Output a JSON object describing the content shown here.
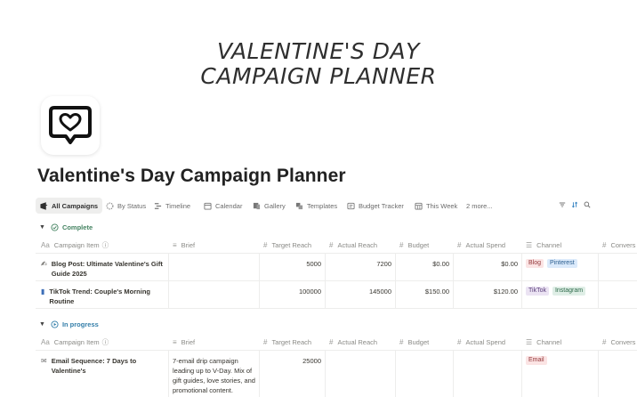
{
  "cover": {
    "title_line1": "VALENTINE'S DAY",
    "title_line2": "CAMPAIGN PLANNER"
  },
  "page": {
    "title": "Valentine's Day Campaign Planner",
    "icon": "heart-message-icon"
  },
  "views": {
    "tabs": [
      {
        "label": "All Campaigns",
        "icon": "table-icon"
      },
      {
        "label": "By Status",
        "icon": "status-icon"
      },
      {
        "label": "Timeline",
        "icon": "timeline-icon"
      },
      {
        "label": "Calendar",
        "icon": "calendar-icon"
      },
      {
        "label": "Gallery",
        "icon": "gallery-icon"
      },
      {
        "label": "Templates",
        "icon": "templates-icon"
      },
      {
        "label": "Budget Tracker",
        "icon": "board-icon"
      },
      {
        "label": "This Week",
        "icon": "calendar-week-icon"
      }
    ],
    "more_label": "2 more..."
  },
  "columns": [
    "Campaign Item",
    "Brief",
    "Target Reach",
    "Actual Reach",
    "Budget",
    "Actual Spend",
    "Channel",
    "Convers"
  ],
  "groups": [
    {
      "label": "Complete",
      "color": "#448361",
      "rows": [
        {
          "name_line1": "Blog Post: Ultimate Valentine's Gift",
          "name_line2": "Guide 2025",
          "icon": "pencil-icon",
          "brief": [
            "",
            "",
            "",
            ""
          ],
          "target_reach": "5000",
          "actual_reach": "7200",
          "budget": "$0.00",
          "actual_spend": "$0.00",
          "channels": [
            "Blog",
            "Pinterest"
          ]
        },
        {
          "name_line1": "TikTok Trend: Couple's Morning",
          "name_line2": "Routine",
          "icon": "phone-icon",
          "brief": [
            "",
            "",
            "",
            ""
          ],
          "target_reach": "100000",
          "actual_reach": "145000",
          "budget": "$150.00",
          "actual_spend": "$120.00",
          "channels": [
            "TikTok",
            "Instagram"
          ]
        }
      ]
    },
    {
      "label": "In progress",
      "color": "#337ea9",
      "rows": [
        {
          "name_line1": "Email Sequence: 7 Days to",
          "name_line2": "Valentine's",
          "icon": "email-icon",
          "brief": [
            "7-email drip campaign",
            "leading up to V-Day. Mix of",
            "gift guides, love stories, and",
            "promotional content."
          ],
          "target_reach": "25000",
          "actual_reach": "",
          "budget": "",
          "actual_spend": "",
          "channels": [
            "Email"
          ]
        }
      ]
    }
  ],
  "channel_colors": {
    "Blog": {
      "bg": "#fbe4e4",
      "fg": "#93373a"
    },
    "Pinterest": {
      "bg": "#dbeafb",
      "fg": "#2b5e8f"
    },
    "TikTok": {
      "bg": "#ebe3f3",
      "fg": "#5a3f7a"
    },
    "Instagram": {
      "bg": "#dfeee6",
      "fg": "#2d6a4a"
    },
    "Email": {
      "bg": "#fbe4e4",
      "fg": "#93373a"
    }
  }
}
